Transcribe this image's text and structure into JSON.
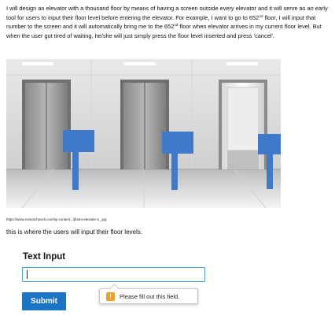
{
  "intro": {
    "p1": "I will design an elevator with a thousand floor by means of having a screen outside every elevator and it will serve as an early tool for users to input their floor level before entering the elevator. For example, I want to go to 652",
    "sup1": "nd",
    "p2": " floor, I will input that number to the screen and it will automatically bring me to the 652",
    "sup2": "nd",
    "p3": " floor when elevator arrives in my current floor level. But when the user got tired of waiting, he/she will just simply press the floor level inserted and press 'cancel'."
  },
  "image": {
    "description": "elevator-lobby-photo-with-floor-input-screens"
  },
  "source_url": "https://www.researchwork.com/sp.content.../photo-elevator-2_.jpg",
  "caption": "this is where the users will input their floor levels.",
  "form": {
    "title": "Text Input",
    "input_value": "",
    "submit_label": "Submit"
  },
  "tooltip": {
    "icon": "!",
    "text": "Please fill out this field."
  },
  "colors": {
    "accent": "#1b75c4",
    "input_border": "#4a9ad6",
    "warning": "#f0a21b",
    "screen_blue": "#3f79c9"
  }
}
